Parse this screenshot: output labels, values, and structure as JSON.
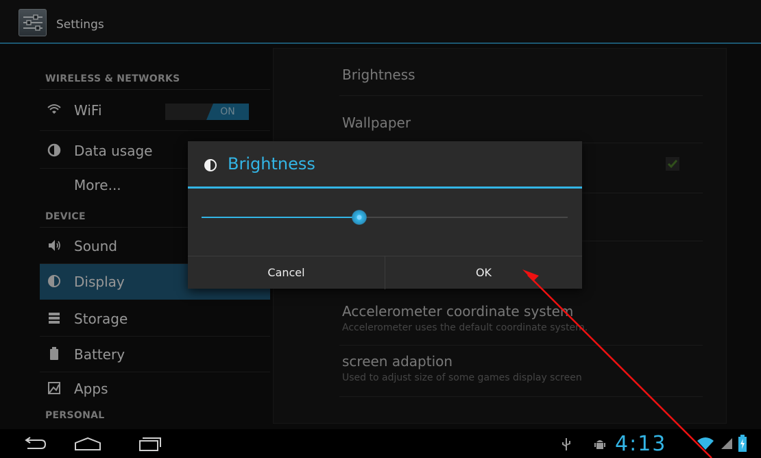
{
  "app_bar": {
    "title": "Settings",
    "icon": "settings-icon"
  },
  "sidebar": {
    "sections": [
      {
        "header": "WIRELESS & NETWORKS"
      },
      {
        "header": "DEVICE"
      },
      {
        "header": "PERSONAL"
      }
    ],
    "items": [
      {
        "label": "WiFi",
        "icon": "wifi-icon",
        "toggle": "ON"
      },
      {
        "label": "Data usage",
        "icon": "data-usage-icon"
      },
      {
        "label": "More..."
      },
      {
        "label": "Sound",
        "icon": "speaker-icon"
      },
      {
        "label": "Display",
        "icon": "brightness-icon",
        "selected": true
      },
      {
        "label": "Storage",
        "icon": "storage-icon"
      },
      {
        "label": "Battery",
        "icon": "battery-icon"
      },
      {
        "label": "Apps",
        "icon": "apps-icon"
      }
    ]
  },
  "display_settings": [
    {
      "title": "Brightness"
    },
    {
      "title": "Wallpaper"
    },
    {
      "title": "Accelerometer coordinate system",
      "subtitle": "Accelerometer uses the default coordinate system."
    },
    {
      "title": "screen adaption",
      "subtitle": "Used to adjust size of some games display screen"
    }
  ],
  "dialog": {
    "title": "Brightness",
    "icon": "brightness-icon",
    "slider_value_fraction": 0.43,
    "cancel_label": "Cancel",
    "ok_label": "OK"
  },
  "status_bar": {
    "clock": "4:13"
  },
  "colors": {
    "accent": "#33b5e5",
    "selected": "#205675",
    "annotation": "#e11"
  }
}
